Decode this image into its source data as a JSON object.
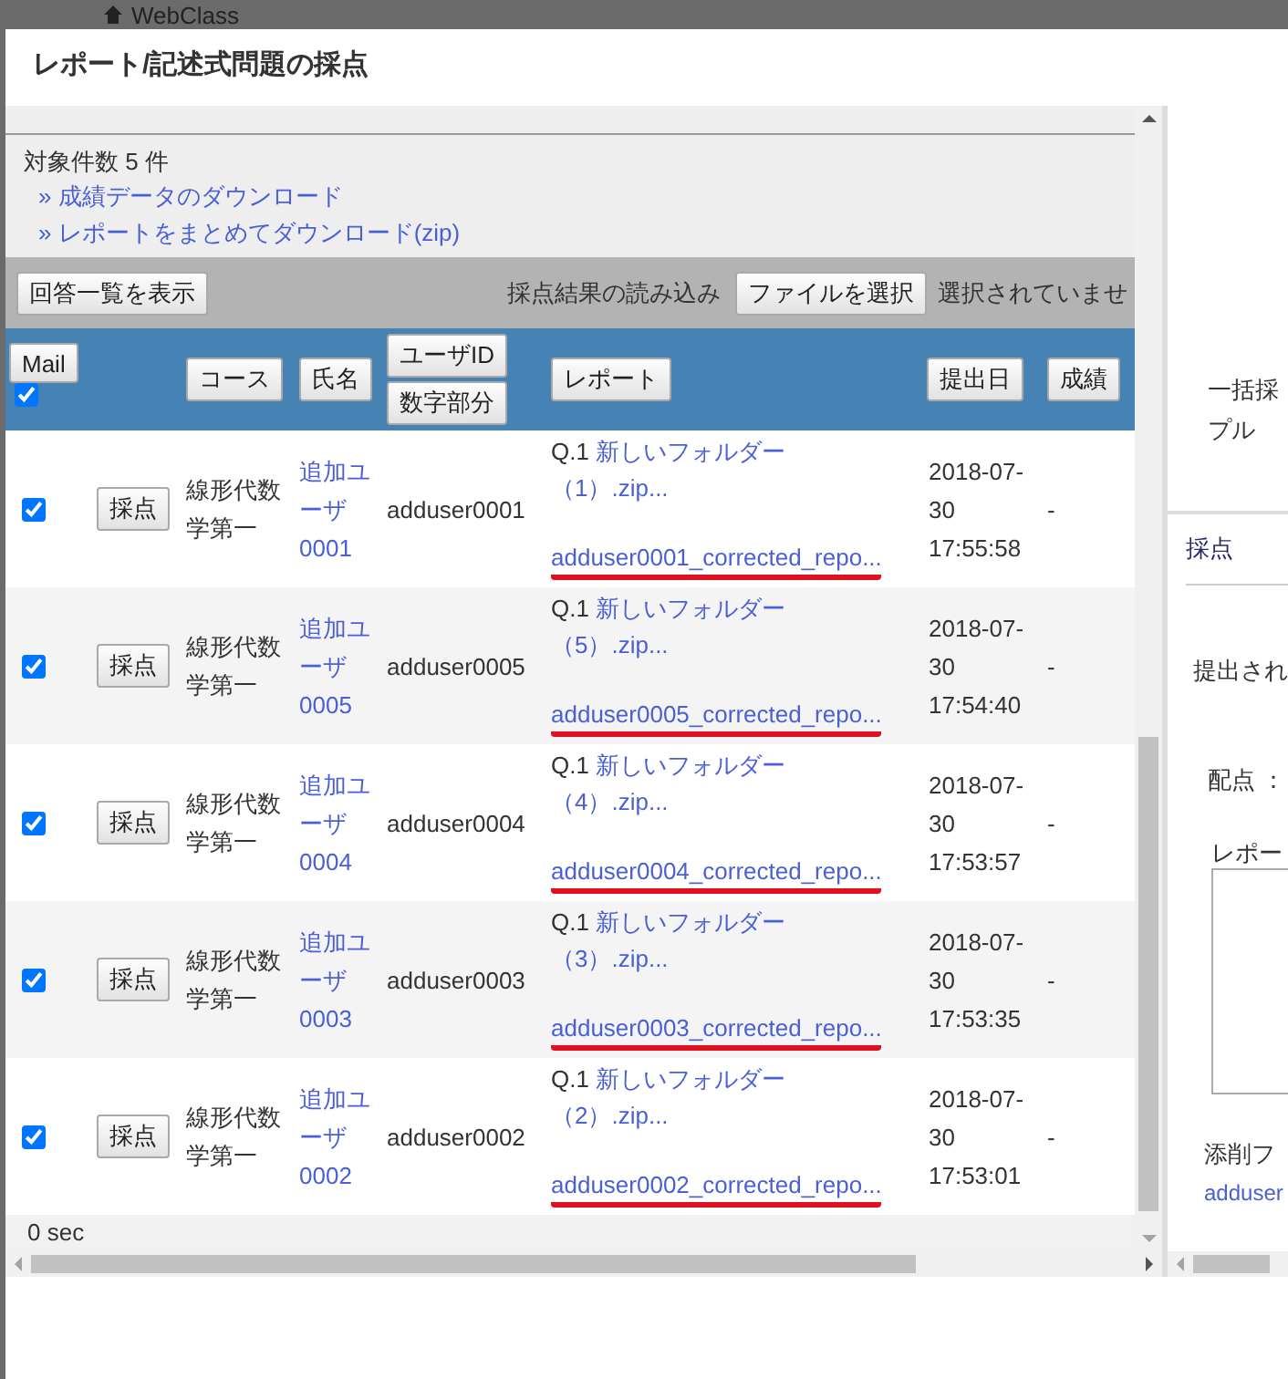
{
  "backdrop": {
    "title": "WebClass"
  },
  "dialog": {
    "title": "レポート/記述式問題の採点"
  },
  "summary": {
    "count_text": "対象件数 5 件",
    "links": [
      "» 成績データのダウンロード",
      "» レポートをまとめてダウンロード(zip)"
    ]
  },
  "toolbar": {
    "list_button": "回答一覧を表示",
    "import_label": "採点結果の読み込み",
    "file_button": "ファイルを選択",
    "file_status": "選択されていませ"
  },
  "header": {
    "mail_button": "Mail",
    "mail_checked": true,
    "columns": [
      {
        "buttons": [
          "コース"
        ]
      },
      {
        "buttons": [
          "氏名"
        ]
      },
      {
        "buttons": [
          "ユーザID",
          "数字部分"
        ]
      },
      {
        "buttons": [
          "レポート"
        ]
      },
      {
        "buttons": [
          "提出日"
        ]
      },
      {
        "buttons": [
          "成績"
        ]
      }
    ]
  },
  "rows": [
    {
      "checked": true,
      "grade_button": "採点",
      "course": "線形代数学第一",
      "name": "追加ユーザ0001",
      "user_id": "adduser0001",
      "question": "Q.1",
      "report_file": "新しいフォルダー（1）.zip...",
      "corrected_file": "adduser0001_corrected_repo...",
      "submitted": "2018-07-30 17:55:58",
      "grade": "-"
    },
    {
      "checked": true,
      "grade_button": "採点",
      "course": "線形代数学第一",
      "name": "追加ユーザ0005",
      "user_id": "adduser0005",
      "question": "Q.1",
      "report_file": "新しいフォルダー（5）.zip...",
      "corrected_file": "adduser0005_corrected_repo...",
      "submitted": "2018-07-30 17:54:40",
      "grade": "-"
    },
    {
      "checked": true,
      "grade_button": "採点",
      "course": "線形代数学第一",
      "name": "追加ユーザ0004",
      "user_id": "adduser0004",
      "question": "Q.1",
      "report_file": "新しいフォルダー（4）.zip...",
      "corrected_file": "adduser0004_corrected_repo...",
      "submitted": "2018-07-30 17:53:57",
      "grade": "-"
    },
    {
      "checked": true,
      "grade_button": "採点",
      "course": "線形代数学第一",
      "name": "追加ユーザ0003",
      "user_id": "adduser0003",
      "question": "Q.1",
      "report_file": "新しいフォルダー（3）.zip...",
      "corrected_file": "adduser0003_corrected_repo...",
      "submitted": "2018-07-30 17:53:35",
      "grade": "-"
    },
    {
      "checked": true,
      "grade_button": "採点",
      "course": "線形代数学第一",
      "name": "追加ユーザ0002",
      "user_id": "adduser0002",
      "question": "Q.1",
      "report_file": "新しいフォルダー（2）.zip...",
      "corrected_file": "adduser0002_corrected_repo...",
      "submitted": "2018-07-30 17:53:01",
      "grade": "-"
    }
  ],
  "footer": {
    "timing": "0 sec"
  },
  "side_panel": {
    "bulk_text": [
      "一括採",
      "プル"
    ],
    "tab": "採点",
    "submitted_label": "提出され",
    "score_label": "配点 ：",
    "report_label": "レポー",
    "correction_label": "添削フ",
    "correction_link": "adduser"
  }
}
